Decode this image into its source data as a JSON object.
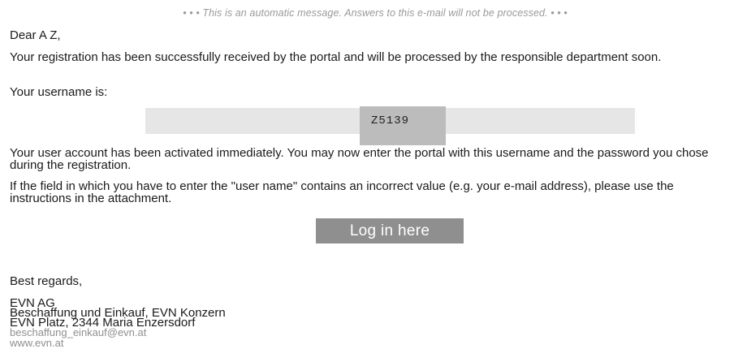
{
  "notice": "• • • This is an automatic message. Answers to this e-mail will not be processed. • • •",
  "greeting": "Dear A Z,",
  "paragraphs": {
    "registration": "Your registration has been successfully received by the portal and will be processed by the responsible department soon.",
    "username_intro": "Your username is:",
    "activation": "Your user account has been activated immediately. You may now enter the portal with this username and the password you chose during the registration.",
    "incorrect_value": "If the field in which you have to enter the \"user name\" contains an incorrect value (e.g. your e-mail address), please use the instructions in the attachment."
  },
  "username": "Z5139",
  "login_button_label": "Log in here",
  "closing": "Best regards,",
  "signature": {
    "company": "EVN AG",
    "department": "Beschaffung und Einkauf, EVN Konzern",
    "address": "EVN Platz, 2344 Maria Enzersdorf",
    "email": "beschaffung_einkauf@evn.at",
    "website": "www.evn.at"
  }
}
